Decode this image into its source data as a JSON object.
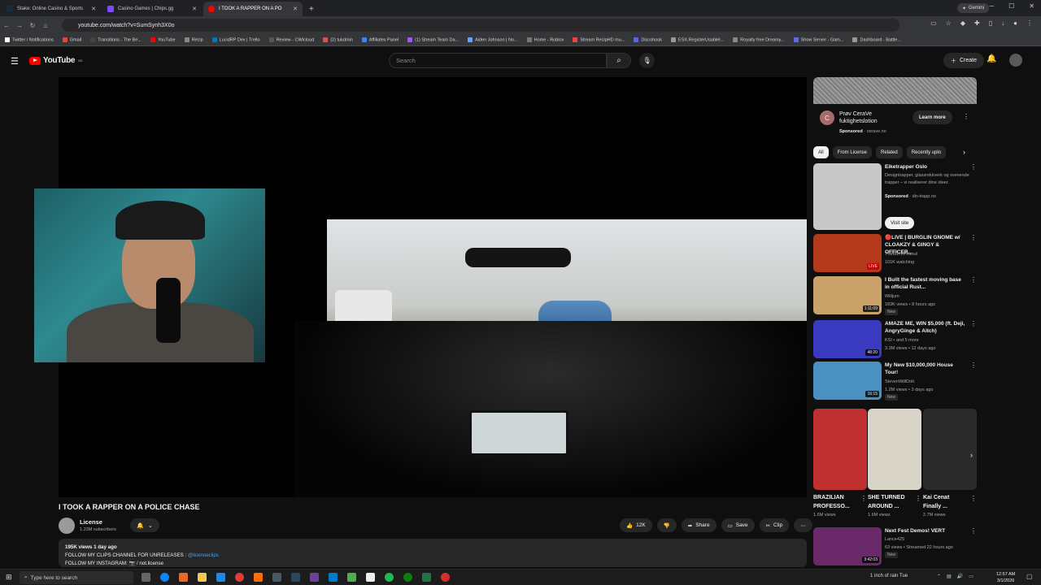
{
  "browser": {
    "tabs": [
      {
        "title": "Stake: Online Casino & Sports",
        "color": "#1a2c38"
      },
      {
        "title": "Casino Games | Chips.gg",
        "color": "#7a4cff"
      },
      {
        "title": "I TOOK A RAPPER ON A PO",
        "color": "#ff0000",
        "active": true
      }
    ],
    "new_tab": "+",
    "gemini": "Gemini",
    "url": "youtube.com/watch?v=SumSynh3X0o",
    "bookmarks": [
      {
        "label": "Twitter / Notifications",
        "color": "#ffffff"
      },
      {
        "label": "Gmail",
        "color": "#ea4335"
      },
      {
        "label": "Transitions - The Be...",
        "color": "#444444"
      },
      {
        "label": "YouTube",
        "color": "#ff0000"
      },
      {
        "label": "ReUp",
        "color": "#888888"
      },
      {
        "label": "LucidRP Dev | Trello",
        "color": "#0079bf"
      },
      {
        "label": "Review - CWIcloud",
        "color": "#555555"
      },
      {
        "label": "(2) tukdmin",
        "color": "#e05050"
      },
      {
        "label": "Affiliates Panel",
        "color": "#3b82f6"
      },
      {
        "label": "(1) Stream Team Da...",
        "color": "#a855f7"
      },
      {
        "label": "Aiden Johnson | No...",
        "color": "#60a5fa"
      },
      {
        "label": "Home - Roblox",
        "color": "#777777"
      },
      {
        "label": "Stream ReUpHD mu...",
        "color": "#ef4444"
      },
      {
        "label": "Discohook",
        "color": "#5865f2"
      },
      {
        "label": "ESX.RegisterUsableI...",
        "color": "#999999"
      },
      {
        "label": "Royalty free Dreamy...",
        "color": "#888888"
      },
      {
        "label": "Show Server - Gam...",
        "color": "#6366f1"
      },
      {
        "label": "Dashboard - Battle...",
        "color": "#999999"
      }
    ]
  },
  "youtube": {
    "logo": "YouTube",
    "region": "BD",
    "search_placeholder": "Search",
    "create": "Create",
    "video_title": "I TOOK A RAPPER ON A POLICE CHASE",
    "channel": "License",
    "subscribers": "1.23M subscribers",
    "likes": "12K",
    "share": "Share",
    "save": "Save",
    "clip": "Clip",
    "description": {
      "meta": "195K views  1 day ago",
      "line1": "FOLLOW MY CLIPS CHANNEL FOR UNRELEASES :",
      "line1_link": "@licenseclips",
      "line2": "FOLLOW MY INSTAGRAM: 📷 / not.license"
    }
  },
  "ad": {
    "avatar_letter": "C",
    "title": "Prøv CeraVe fuktighetslotion",
    "sponsored": "Sponsored",
    "domain": "cerave.no",
    "cta": "Learn more"
  },
  "chips": [
    "All",
    "From License",
    "Related",
    "Recently uplo"
  ],
  "sidebar_ad": {
    "title": "Eiketrapper Oslo",
    "desc": "Designtrapper, glassrekkverk og svevende trapper – vi realiserer dine ideer.",
    "sponsored": "Sponsored",
    "domain": "din-trapp.no",
    "cta": "Visit site"
  },
  "recs": [
    {
      "title": "🔴LIVE | BURGLIN GNOME w/ CLOAKZY & GINGY & OFFICER...",
      "channel": "TheBurntPeanut",
      "meta": "101K watching",
      "live": "LIVE",
      "thumb": "#b23a1a"
    },
    {
      "title": "I Built the fastest moving base in official Rust...",
      "channel": "Willjum",
      "meta": "183K views • 8 hours ago",
      "badge": "New",
      "dur": "1:11:09",
      "thumb": "#c9a36a"
    },
    {
      "title": "AMAZE ME, WIN $5,000 (ft. Deji, AngryGinge & Aitch)",
      "channel": "KSI • and 5 more",
      "meta": "3.3M views • 12 days ago",
      "dur": "48:20",
      "thumb": "#3a3ac0"
    },
    {
      "title": "My New $10,000,000 House Tour!",
      "channel": "StevenWillDoIt",
      "meta": "1.2M views • 3 days ago",
      "badge": "New",
      "dur": "16:15",
      "thumb": "#4a90c0"
    }
  ],
  "shorts": [
    {
      "title": "BRAZILIAN PROFESSO...",
      "views": "1.6M views",
      "thumb": "#c03030"
    },
    {
      "title": "SHE TURNED AROUND ...",
      "views": "1.6M views",
      "thumb": "#d9d4c8"
    },
    {
      "title": "Kai Cenat Finally ...",
      "views": "2.7M views",
      "thumb": "#2a2a2a"
    }
  ],
  "last_rec": {
    "title": "Next Fest Demos! VERT",
    "channel": "Lance425",
    "meta": "63 views • Streamed 22 hours ago",
    "badge": "New",
    "dur": "3:42:03",
    "thumb": "#6a2a6a"
  },
  "taskbar": {
    "search": "Type here to search",
    "weather": "1 inch of rain Tue",
    "time": "12:57 AM",
    "date": "3/1/2026"
  }
}
